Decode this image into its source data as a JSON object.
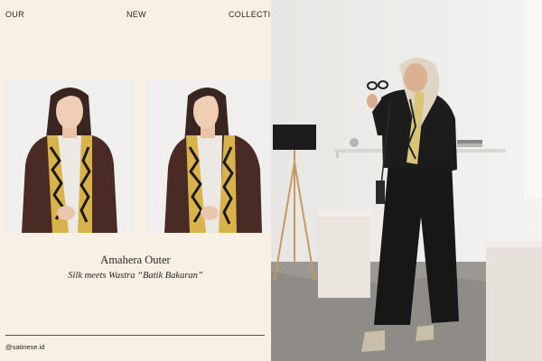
{
  "header": {
    "word1": "OUR",
    "word2": "NEW",
    "word3": "COLLECTIO"
  },
  "product": {
    "title": "Amahera Outer",
    "subtitle": "Silk meets Wastra “Batik Bakaran”"
  },
  "footer": {
    "handle": "@satinese.id"
  },
  "photos": {
    "left_front": "model-front-photo",
    "left_side": "model-side-photo",
    "right_scene": "hijab-model-lifestyle-photo"
  },
  "colors": {
    "panel_bg": "#f8f0e4",
    "outer_brown": "#4a2a25",
    "batik_gold": "#d8b24a",
    "outfit_black": "#171717"
  }
}
